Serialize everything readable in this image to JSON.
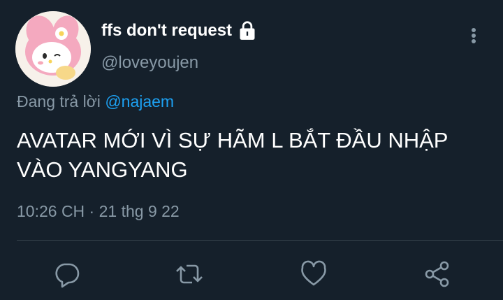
{
  "tweet": {
    "display_name": "ffs don't request",
    "handle": "@loveyoujen",
    "reply_prefix": "Đang trả lời",
    "reply_mention": "@najaem",
    "text": "AVATAR MỚI VÌ SỰ HÃM L BẮT ĐẦU NHẬP VÀO YANGYANG",
    "timestamp": "10:26 CH · 21 thg 9 22"
  },
  "icons": {
    "lock": "lock-icon",
    "more": "more-vertical-icon",
    "reply": "comment-icon",
    "retweet": "retweet-icon",
    "like": "heart-icon",
    "share": "share-icon"
  },
  "colors": {
    "background": "#15202b",
    "text": "#ffffff",
    "muted": "#8899a6",
    "link": "#1da1f2",
    "divider": "#38444d"
  }
}
